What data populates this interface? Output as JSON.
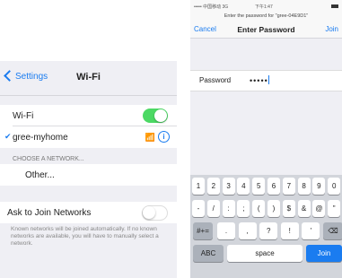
{
  "left": {
    "back_label": "Settings",
    "title": "Wi-Fi",
    "wifi_label": "Wi-Fi",
    "wifi_toggle_on": true,
    "connected_network": "gree-myhome",
    "section_header": "CHOOSE A NETWORK...",
    "other_label": "Other...",
    "ask_label": "Ask to Join Networks",
    "ask_toggle_on": false,
    "footer_text": "Known networks will be joined automatically. If no known networks are available, you will have to manually select a network."
  },
  "right": {
    "status_carrier": "••••• 中国移动  3G",
    "status_time": "下午1:47",
    "subtitle": "Enter the password for \"gree-04E9D1\"",
    "cancel_label": "Cancel",
    "title": "Enter Password",
    "join_label": "Join",
    "password_label": "Password",
    "password_value": "•••••",
    "keyboard": {
      "row1": [
        "1",
        "2",
        "3",
        "4",
        "5",
        "6",
        "7",
        "8",
        "9",
        "0"
      ],
      "row2": [
        "-",
        "/",
        ":",
        ";",
        "(",
        ")",
        "$",
        "&",
        "@",
        "\""
      ],
      "row3_left": "#+=",
      "row3": [
        ".",
        ",",
        "?",
        "!",
        "'"
      ],
      "row3_right": "⌫",
      "abc": "ABC",
      "space": "space",
      "join": "Join"
    }
  }
}
